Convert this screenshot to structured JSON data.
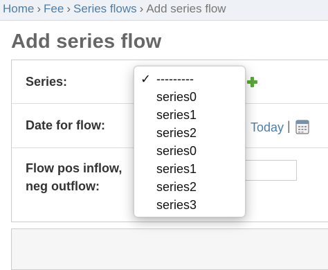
{
  "breadcrumbs": {
    "items": [
      "Home",
      "Fee",
      "Series flows"
    ],
    "separator": "›",
    "current": "Add series flow"
  },
  "page": {
    "title": "Add series flow"
  },
  "form": {
    "series_label": "Series:",
    "date_label": "Date for flow:",
    "date_today_link": "Today",
    "date_separator": "|",
    "flow_label": "Flow pos inflow, neg outflow:",
    "flow_value": ""
  },
  "dropdown": {
    "selected_marker": "✓",
    "options": [
      "---------",
      "series0",
      "series1",
      "series2",
      "series0",
      "series1",
      "series2",
      "series3"
    ]
  },
  "icons": {
    "add": "add-another-plus-icon",
    "calendar": "calendar-icon"
  },
  "colors": {
    "link": "#4e7ea7",
    "breadcrumb_bg": "#eef2f6",
    "add_green": "#5aa83a"
  }
}
